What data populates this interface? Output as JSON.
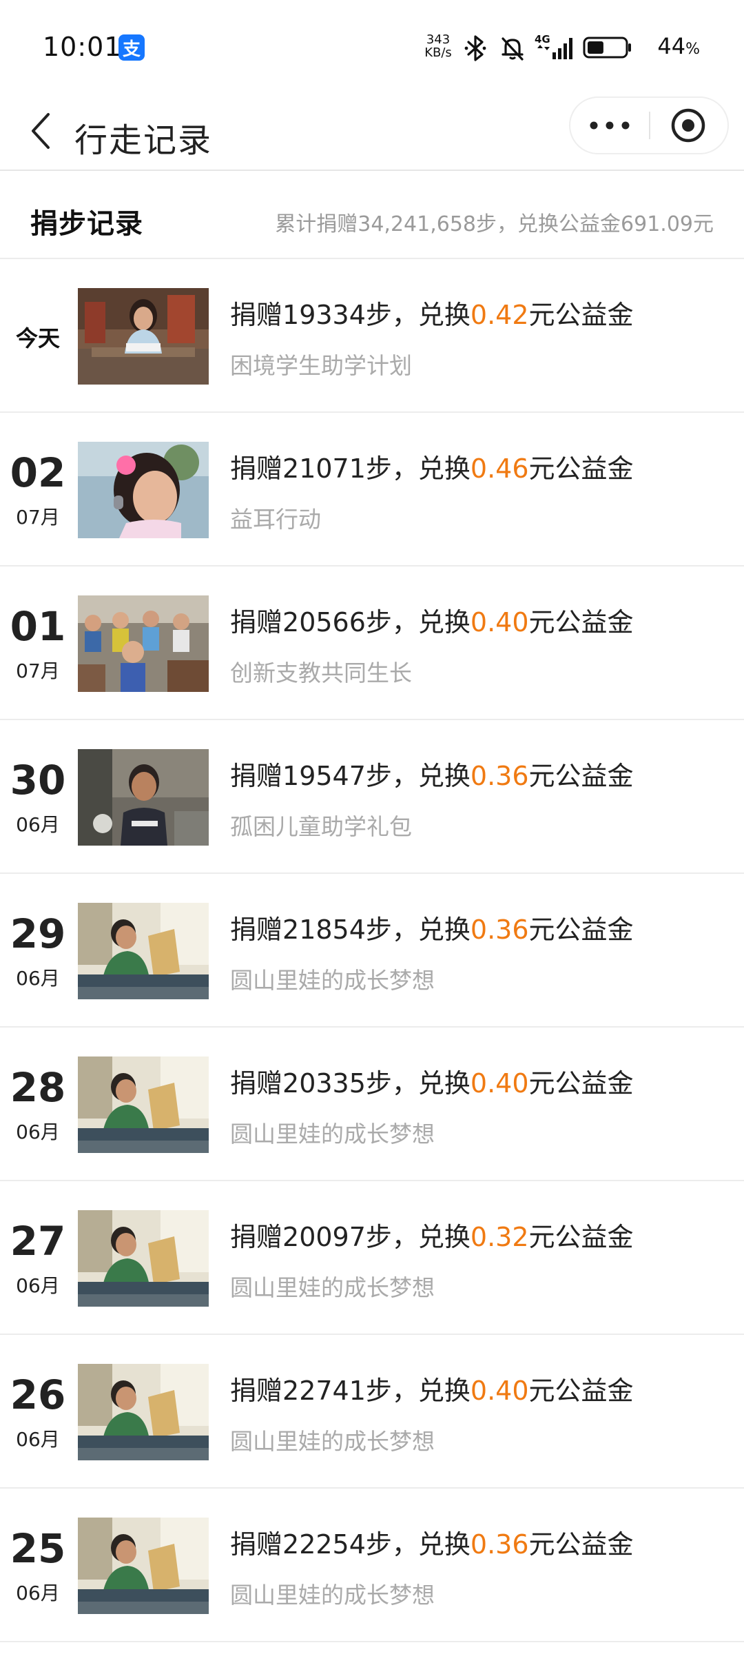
{
  "status_bar": {
    "time": "10:01",
    "app_badge": "支",
    "net_speed_value": "343",
    "net_speed_unit": "KB/s",
    "network": "4G",
    "battery_percent": "44",
    "battery_unit": "%",
    "battery_level": 0.44,
    "icons": [
      "alipay-icon",
      "bluetooth-icon",
      "mute-bell-icon",
      "signal-icon",
      "battery-icon"
    ]
  },
  "nav": {
    "back_icon": "chevron-left-icon",
    "title": "行走记录",
    "more_icon": "more-dots-icon",
    "close_icon": "target-close-icon"
  },
  "summary": {
    "title": "捐步记录",
    "total": "累计捐赠34,241,658步，兑换公益金691.09元"
  },
  "text": {
    "prefix": "捐赠",
    "steps_suffix": "步，兑换",
    "money_suffix": "元公益金"
  },
  "colors": {
    "amount": "#f07a12",
    "project": "#aaaaaa",
    "alipay": "#1677ff"
  },
  "records": [
    {
      "today_label": "今天",
      "day": "",
      "month": "",
      "steps": "19334",
      "amount": "0.42",
      "project": "困境学生助学计划",
      "thumb": "girl-reading-photo"
    },
    {
      "today_label": "",
      "day": "02",
      "month": "07月",
      "steps": "21071",
      "amount": "0.46",
      "project": "益耳行动",
      "thumb": "girl-with-hearing-aid-photo"
    },
    {
      "today_label": "",
      "day": "01",
      "month": "07月",
      "steps": "20566",
      "amount": "0.40",
      "project": "创新支教共同生长",
      "thumb": "classroom-children-photo"
    },
    {
      "today_label": "",
      "day": "30",
      "month": "06月",
      "steps": "19547",
      "amount": "0.36",
      "project": "孤困儿童助学礼包",
      "thumb": "boy-portrait-photo"
    },
    {
      "today_label": "",
      "day": "29",
      "month": "06月",
      "steps": "21854",
      "amount": "0.36",
      "project": "圆山里娃的成长梦想",
      "thumb": "boy-reading-book-photo"
    },
    {
      "today_label": "",
      "day": "28",
      "month": "06月",
      "steps": "20335",
      "amount": "0.40",
      "project": "圆山里娃的成长梦想",
      "thumb": "boy-reading-book-photo"
    },
    {
      "today_label": "",
      "day": "27",
      "month": "06月",
      "steps": "20097",
      "amount": "0.32",
      "project": "圆山里娃的成长梦想",
      "thumb": "boy-reading-book-photo"
    },
    {
      "today_label": "",
      "day": "26",
      "month": "06月",
      "steps": "22741",
      "amount": "0.40",
      "project": "圆山里娃的成长梦想",
      "thumb": "boy-reading-book-photo"
    },
    {
      "today_label": "",
      "day": "25",
      "month": "06月",
      "steps": "22254",
      "amount": "0.36",
      "project": "圆山里娃的成长梦想",
      "thumb": "boy-reading-book-photo"
    }
  ]
}
